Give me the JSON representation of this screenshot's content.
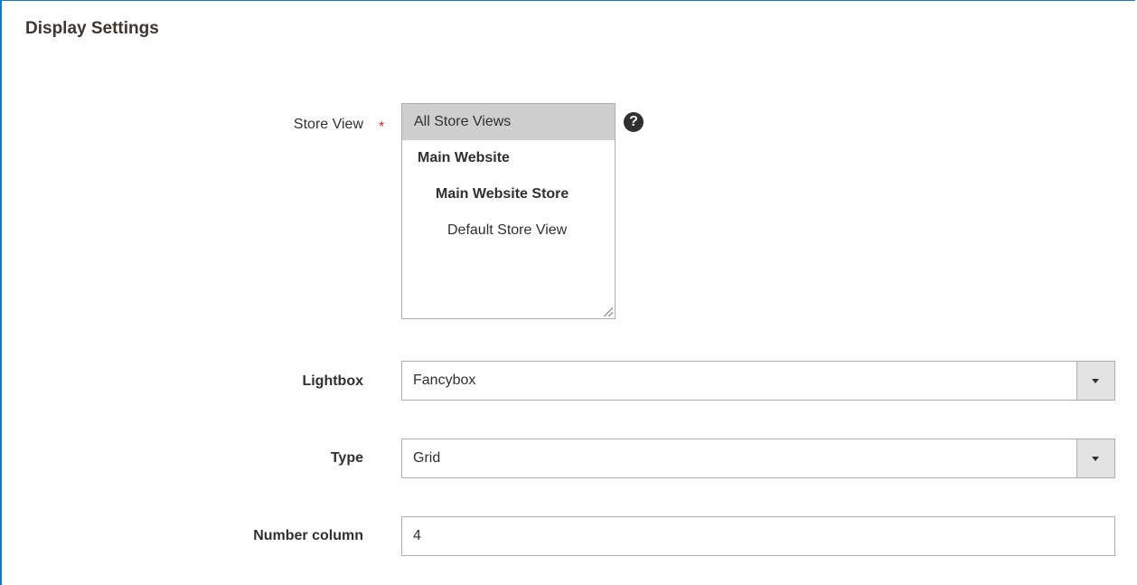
{
  "section": {
    "title": "Display Settings"
  },
  "store_view": {
    "label": "Store View",
    "required_mark": "*",
    "help_icon": "question-circle-icon",
    "help_glyph": "?",
    "options": [
      {
        "label": "All Store Views",
        "selected": true
      },
      {
        "label": "Main Website",
        "selected": false
      },
      {
        "label": "Main Website Store",
        "selected": false
      },
      {
        "label": "Default Store View",
        "selected": false
      }
    ]
  },
  "lightbox": {
    "label": "Lightbox",
    "value": "Fancybox",
    "arrow_icon": "caret-down-icon"
  },
  "type": {
    "label": "Type",
    "value": "Grid",
    "arrow_icon": "caret-down-icon"
  },
  "number_column": {
    "label": "Number column",
    "value": "4"
  },
  "colors": {
    "accent_border": "#1979c3",
    "required": "#e22626",
    "selected_option_bg": "#cecece"
  }
}
